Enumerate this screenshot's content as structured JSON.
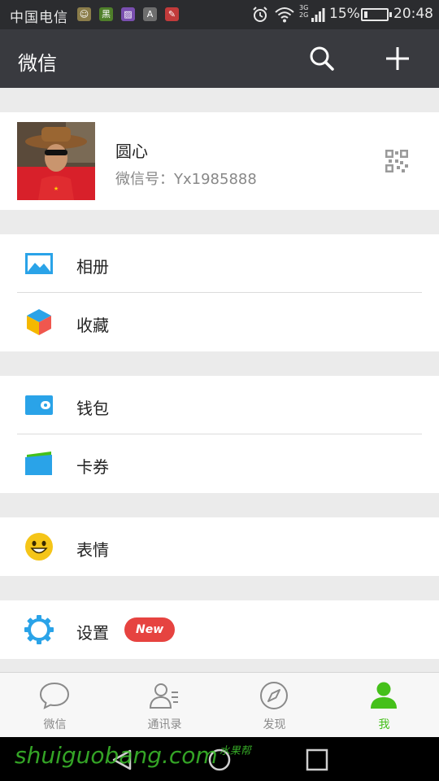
{
  "status_bar": {
    "carrier": "中国电信",
    "notification_icons": [
      {
        "name": "app-notification-icon-1",
        "color": "#8b7d4a",
        "glyph": "☺"
      },
      {
        "name": "app-notification-icon-2",
        "color": "#4f7f2a",
        "glyph": "黑"
      },
      {
        "name": "gallery-notification-icon",
        "color": "#7a4fb0",
        "glyph": "▨"
      },
      {
        "name": "app-notification-icon-4",
        "color": "#6e6e6e",
        "glyph": "A"
      },
      {
        "name": "app-notification-icon-5",
        "color": "#c23b3b",
        "glyph": "✎"
      }
    ],
    "network_top": "3G",
    "network_bottom": "2G",
    "battery_percent": "15%",
    "battery_level": 0.15,
    "time": "20:48"
  },
  "header": {
    "title": "微信",
    "search_icon": "search-icon",
    "add_icon": "plus-icon"
  },
  "profile": {
    "nickname": "圆心",
    "wechat_id": "微信号：Yx1985888",
    "qr_icon": "qr-code-icon"
  },
  "menu": {
    "album": {
      "label": "相册",
      "icon": "album-icon"
    },
    "favorites": {
      "label": "收藏",
      "icon": "favorites-cube-icon"
    },
    "wallet": {
      "label": "钱包",
      "icon": "wallet-icon"
    },
    "cards": {
      "label": "卡券",
      "icon": "card-icon"
    },
    "stickers": {
      "label": "表情",
      "icon": "smiley-icon"
    },
    "settings": {
      "label": "设置",
      "icon": "gear-icon",
      "badge": "New"
    }
  },
  "tabs": [
    {
      "label": "微信",
      "icon": "chat-bubble-icon",
      "active": false
    },
    {
      "label": "通讯录",
      "icon": "contacts-icon",
      "active": false
    },
    {
      "label": "发现",
      "icon": "compass-icon",
      "active": false
    },
    {
      "label": "我",
      "icon": "person-icon",
      "active": true
    }
  ],
  "colors": {
    "accent_green": "#45c01a",
    "badge_red": "#e64340",
    "title_bar": "#393a3f",
    "icon_blue": "#2aa3e8",
    "smiley_yellow": "#f5c518"
  },
  "watermark": {
    "text": "shuiguobang.com",
    "suffix": "水果帮"
  }
}
